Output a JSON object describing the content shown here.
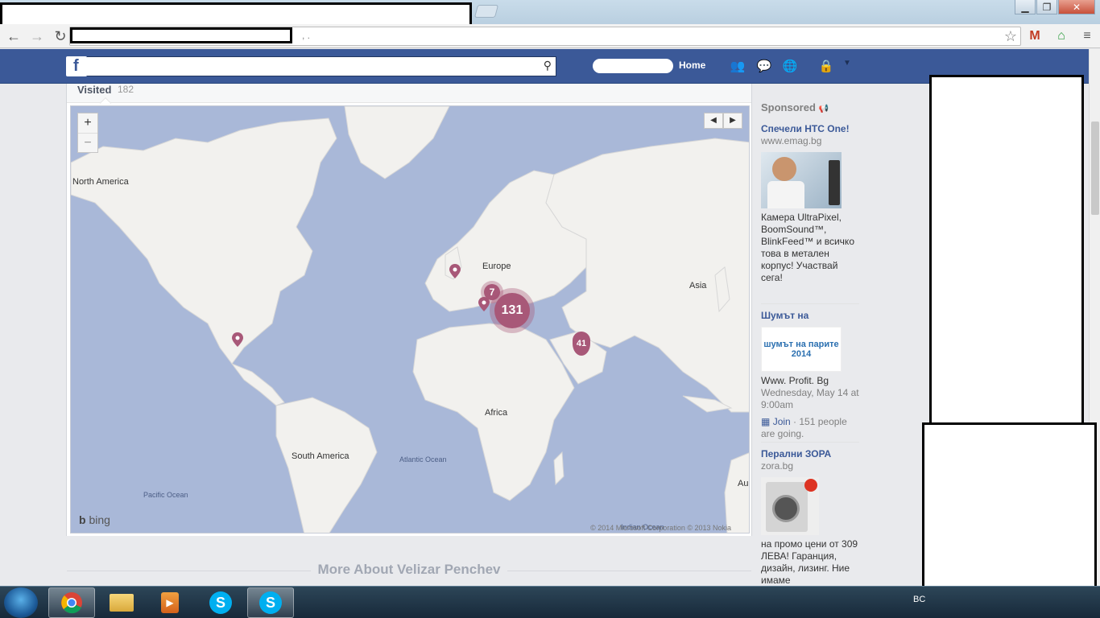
{
  "browser": {
    "window_controls": {
      "minimize": "▁",
      "maximize": "❐",
      "close": "✕"
    },
    "nav": {
      "back": "←",
      "forward": "→",
      "reload": "↻"
    },
    "url_rest": ",            .",
    "extensions": [
      "star-icon",
      "gmail-icon",
      "home-icon",
      "menu-icon"
    ]
  },
  "facebook_bar": {
    "logo": "f",
    "home_label": "Home"
  },
  "places": {
    "tab_label": "Visited",
    "tab_count": "182",
    "map": {
      "zoom_in": "+",
      "zoom_out": "−",
      "prev": "◀",
      "next": "▶",
      "continents": [
        "North America",
        "Europe",
        "Asia",
        "Africa",
        "South America",
        "Au"
      ],
      "oceans": [
        "Atlantic Ocean",
        "Pacific Ocean",
        "Indian Ocean"
      ],
      "clusters": [
        {
          "count": "7"
        },
        {
          "count": "131"
        },
        {
          "count": "41"
        }
      ],
      "bing_label": "bing",
      "copyright": "© 2014 Microsoft Corporation  © 2013 Nokia",
      "colors": {
        "water": "#a9b8d8",
        "land": "#f2f1ee",
        "marker": "#a85878"
      }
    },
    "more_about": "More About Velizar Penchev"
  },
  "ads": {
    "sponsored_label": "Sponsored",
    "items": [
      {
        "title": "Спечели HTC One!",
        "url": "www.emag.bg",
        "text": "Камера UltraPixel, BoomSound™, BlinkFeed™ и всичко това в метален корпус! Участвай сега!"
      },
      {
        "title": "Шумът на",
        "logo_text": "шумът на парите 2014",
        "url": "Www. Profit. Bg",
        "event_time": "Wednesday, May 14 at 9:00am",
        "join_label": "Join",
        "going": "· 151 people are going."
      },
      {
        "title": "Перални ЗОРА",
        "url": "zora.bg",
        "text": "на промо цени от 309 ЛЕВА! Гаранция, дизайн, лизинг. Ние имаме"
      }
    ]
  },
  "taskbar": {
    "items": [
      "chrome-icon",
      "explorer-icon",
      "media-icon",
      "skype-icon",
      "skype-active-icon"
    ],
    "tray_text": "BC"
  }
}
